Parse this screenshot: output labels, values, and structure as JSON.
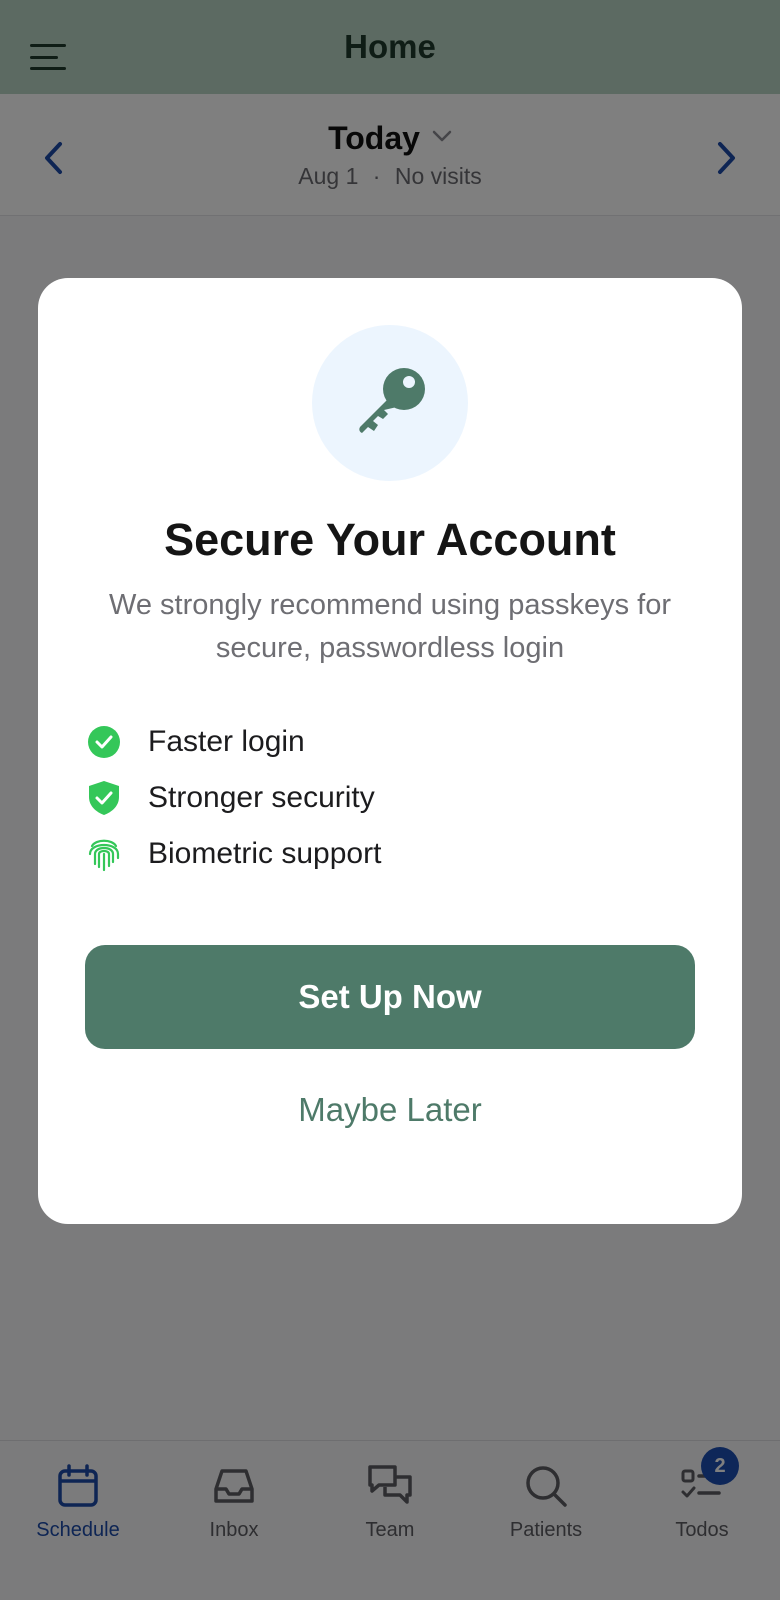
{
  "header": {
    "title": "Home",
    "menu_icon": "hamburger-menu-icon"
  },
  "date_nav": {
    "title": "Today",
    "date": "Aug 1",
    "separator": "·",
    "visits": "No visits",
    "prev_icon": "chevron-left-icon",
    "next_icon": "chevron-right-icon",
    "dropdown_icon": "chevron-down-icon"
  },
  "modal": {
    "icon": "key-icon",
    "title": "Secure Your Account",
    "description": "We strongly recommend using passkeys for secure, passwordless login",
    "features": [
      {
        "icon": "check-circle-icon",
        "label": "Faster login"
      },
      {
        "icon": "shield-check-icon",
        "label": "Stronger security"
      },
      {
        "icon": "fingerprint-icon",
        "label": "Biometric support"
      }
    ],
    "primary_button": "Set Up Now",
    "secondary_button": "Maybe Later"
  },
  "tabbar": {
    "tabs": [
      {
        "label": "Schedule",
        "icon": "calendar-icon",
        "active": true
      },
      {
        "label": "Inbox",
        "icon": "inbox-icon",
        "active": false
      },
      {
        "label": "Team",
        "icon": "chat-bubbles-icon",
        "active": false
      },
      {
        "label": "Patients",
        "icon": "search-icon",
        "active": false
      },
      {
        "label": "Todos",
        "icon": "checklist-icon",
        "active": false,
        "badge": "2"
      }
    ]
  },
  "colors": {
    "header_bg": "#b9d4c4",
    "accent_green": "#4e7a69",
    "active_blue": "#1c4aa8",
    "success_green": "#34c759",
    "badge_blue": "#1d4fb3"
  }
}
